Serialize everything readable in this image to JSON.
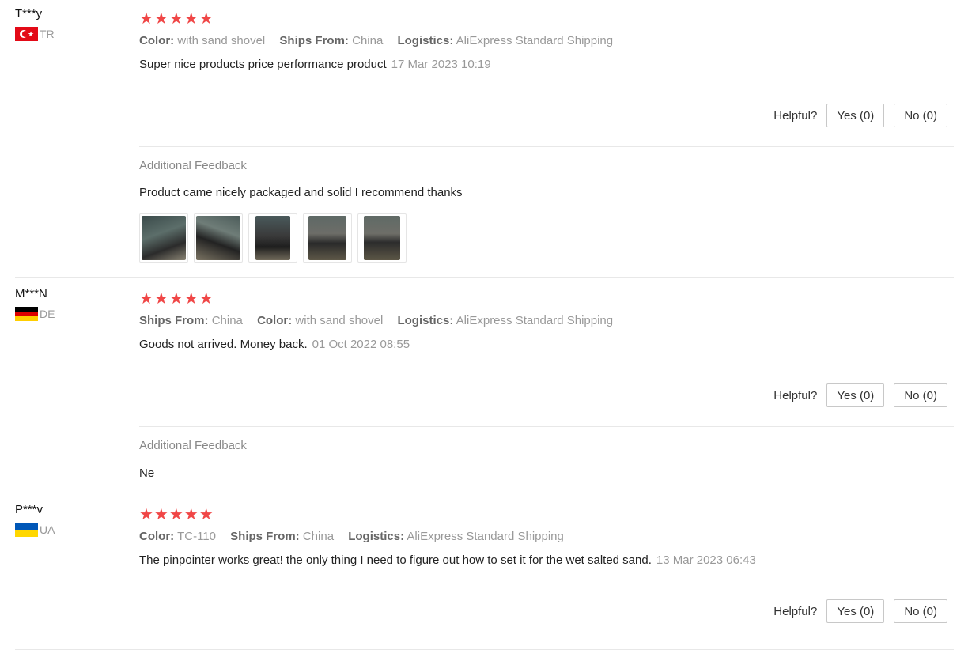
{
  "reviews": [
    {
      "user": "T***y",
      "country": "TR",
      "stars": "★★★★★",
      "meta": [
        {
          "k": "Color:",
          "v": "with sand shovel"
        },
        {
          "k": "Ships From:",
          "v": "China"
        },
        {
          "k": "Logistics:",
          "v": "AliExpress Standard Shipping"
        }
      ],
      "text": "Super nice products price performance product",
      "date": "17 Mar 2023 10:19",
      "helpful_label": "Helpful?",
      "yes_label": "Yes (0)",
      "no_label": "No (0)",
      "additional_title": "Additional Feedback",
      "additional_text": "Product came nicely packaged and solid I recommend thanks",
      "photo_count": 5
    },
    {
      "user": "M***N",
      "country": "DE",
      "stars": "★★★★★",
      "meta": [
        {
          "k": "Ships From:",
          "v": "China"
        },
        {
          "k": "Color:",
          "v": "with sand shovel"
        },
        {
          "k": "Logistics:",
          "v": "AliExpress Standard Shipping"
        }
      ],
      "text": "Goods not arrived. Money back.",
      "date": "01 Oct 2022 08:55",
      "helpful_label": "Helpful?",
      "yes_label": "Yes (0)",
      "no_label": "No (0)",
      "additional_title": "Additional Feedback",
      "additional_text": "Ne"
    },
    {
      "user": "P***v",
      "country": "UA",
      "stars": "★★★★★",
      "meta": [
        {
          "k": "Color:",
          "v": "TC-110"
        },
        {
          "k": "Ships From:",
          "v": "China"
        },
        {
          "k": "Logistics:",
          "v": "AliExpress Standard Shipping"
        }
      ],
      "text": "The pinpointer works great! the only thing I need to figure out how to set it for the wet salted sand.",
      "date": "13 Mar 2023 06:43",
      "helpful_label": "Helpful?",
      "yes_label": "Yes (0)",
      "no_label": "No (0)"
    }
  ],
  "colors": {
    "star": "#f04646",
    "muted": "#999999",
    "divider": "#e8e8e8"
  }
}
